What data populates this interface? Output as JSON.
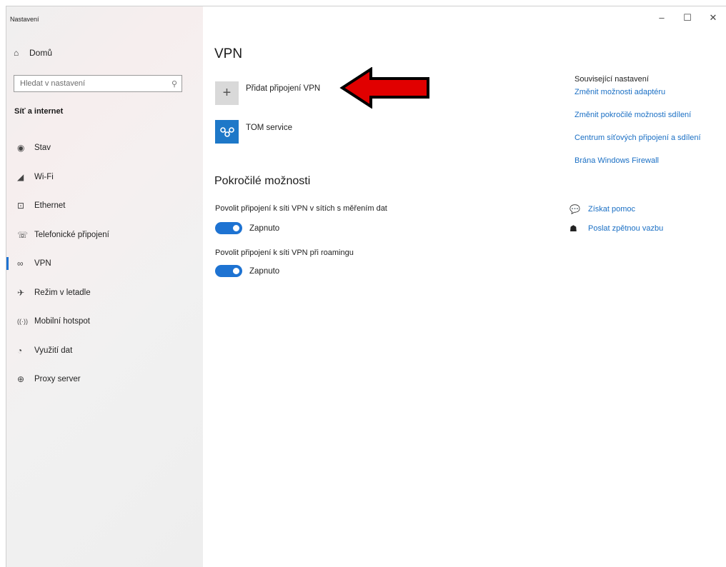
{
  "window": {
    "title": "Nastavení",
    "controls": {
      "minimize": "–",
      "maximize": "☐",
      "close": "✕"
    }
  },
  "sidebar": {
    "home_label": "Domů",
    "search_placeholder": "Hledat v nastavení",
    "section_title": "Síť a internet",
    "items": [
      {
        "label": "Stav",
        "icon": "status-globe-icon",
        "glyph": "◉",
        "active": false
      },
      {
        "label": "Wi-Fi",
        "icon": "wifi-icon",
        "glyph": "◢",
        "active": false
      },
      {
        "label": "Ethernet",
        "icon": "ethernet-icon",
        "glyph": "⊡",
        "active": false
      },
      {
        "label": "Telefonické připojení",
        "icon": "dialup-icon",
        "glyph": "☏",
        "active": false
      },
      {
        "label": "VPN",
        "icon": "vpn-icon",
        "glyph": "∞",
        "active": true
      },
      {
        "label": "Režim v letadle",
        "icon": "airplane-icon",
        "glyph": "✈",
        "active": false
      },
      {
        "label": "Mobilní hotspot",
        "icon": "hotspot-icon",
        "glyph": "((·))",
        "active": false
      },
      {
        "label": "Využití dat",
        "icon": "data-usage-icon",
        "glyph": "◔",
        "active": false
      },
      {
        "label": "Proxy server",
        "icon": "proxy-globe-icon",
        "glyph": "⊕",
        "active": false
      }
    ]
  },
  "main": {
    "title": "VPN",
    "add_vpn_label": "Přidat připojení VPN",
    "add_vpn_glyph": "+",
    "connection_name": "TOM service",
    "advanced_title": "Pokročilé možnosti",
    "option1_label": "Povolit připojení k síti VPN v sítích s měřením dat",
    "option1_state": "Zapnuto",
    "option2_label": "Povolit připojení k síti VPN při roamingu",
    "option2_state": "Zapnuto"
  },
  "related": {
    "heading": "Související nastavení",
    "links": [
      "Změnit možnosti adaptéru",
      "Změnit pokročilé možnosti sdílení",
      "Centrum síťových připojení a sdílení",
      "Brána Windows Firewall"
    ],
    "help_label": "Získat pomoc",
    "feedback_label": "Poslat zpětnou vazbu"
  },
  "colors": {
    "accent": "#1e73d2",
    "link": "#1a6fc4",
    "arrow": "#e10000",
    "vpn_tile": "#1e78c8"
  }
}
